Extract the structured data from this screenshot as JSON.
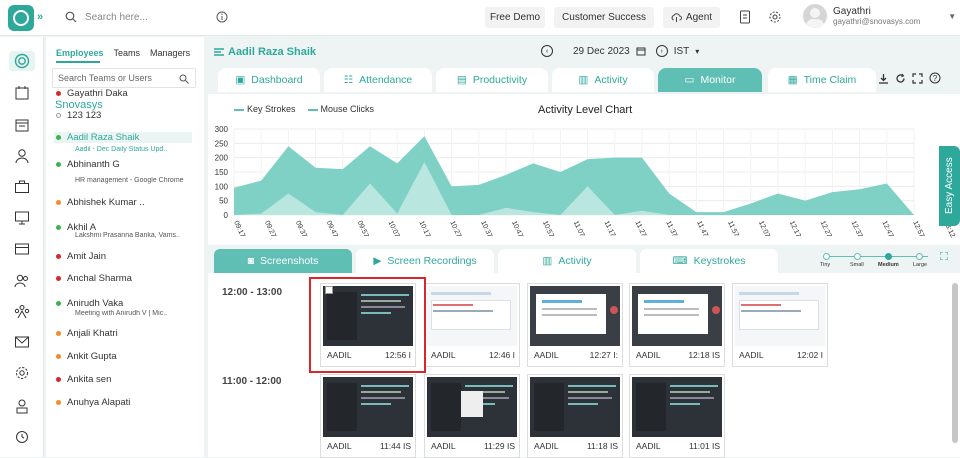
{
  "header": {
    "search_placeholder": "Search here...",
    "free_demo": "Free Demo",
    "customer_success": "Customer Success",
    "agent": "Agent",
    "user_name": "Gayathri",
    "user_email": "gayathri@snovasys.com"
  },
  "panel": {
    "tabs": [
      "Employees",
      "Teams",
      "Managers"
    ],
    "search_placeholder": "Search Teams or Users",
    "org": "Snovasys",
    "employees": [
      {
        "name": "Gayathri Daka",
        "status": "red"
      },
      {
        "name": "123 123",
        "status": "none"
      },
      {
        "name": "Aadil Raza Shaik",
        "status": "green",
        "sub": "Aadil - Dec Daily Status Upd.."
      },
      {
        "name": "Abhinanth G",
        "status": "green",
        "sub": "HR management - Google Chrome"
      },
      {
        "name": "Abhishek Kumar ..",
        "status": "orange"
      },
      {
        "name": "Akhil A",
        "status": "green",
        "sub": "Lakshmi Prasanna Banka, Vams.."
      },
      {
        "name": "Amit Jain",
        "status": "red"
      },
      {
        "name": "Anchal Sharma",
        "status": "red"
      },
      {
        "name": "Anirudh Vaka",
        "status": "green",
        "sub": "Meeting with Anirudh V | Mic.."
      },
      {
        "name": "Anjali Khatri",
        "status": "orange"
      },
      {
        "name": "Ankit Gupta",
        "status": "orange"
      },
      {
        "name": "Ankita sen",
        "status": "red"
      },
      {
        "name": "Anuhya Alapati",
        "status": "orange"
      }
    ]
  },
  "main": {
    "title": "Aadil Raza Shaik",
    "date": "29 Dec 2023",
    "timezone": "IST",
    "tabs": [
      "Dashboard",
      "Attendance",
      "Productivity",
      "Activity",
      "Monitor",
      "Time Claim"
    ],
    "sub_tabs": [
      "Screenshots",
      "Screen Recordings",
      "Activity",
      "Keystrokes"
    ],
    "sizes": [
      "Tiny",
      "Small",
      "Medium",
      "Large"
    ],
    "easy_access": "Easy Access"
  },
  "chart_data": {
    "type": "area",
    "title": "Activity Level Chart",
    "series": [
      {
        "name": "Key Strokes",
        "values": [
          0,
          0,
          0,
          0,
          0,
          0,
          0,
          0,
          0,
          0,
          0,
          0,
          0,
          0,
          0,
          0,
          0,
          0,
          0,
          0,
          0,
          0,
          0,
          0,
          0,
          0
        ]
      },
      {
        "name": "Mouse Clicks",
        "values": [
          95,
          120,
          240,
          165,
          160,
          240,
          180,
          275,
          100,
          105,
          140,
          180,
          150,
          195,
          200,
          200,
          75,
          10,
          10,
          40,
          75,
          50,
          80,
          90,
          110,
          0
        ]
      }
    ],
    "mouse_fill": [
      0,
      5,
      75,
      10,
      0,
      110,
      5,
      185,
      0,
      0,
      25,
      10,
      0,
      100,
      0,
      15,
      0,
      0,
      0,
      0,
      0,
      0,
      0,
      0,
      0,
      0
    ],
    "x": [
      "09:17",
      "09:27",
      "09:37",
      "09:47",
      "09:57",
      "10:07",
      "10:17",
      "10:27",
      "10:37",
      "10:47",
      "10:57",
      "11:07",
      "11:17",
      "11:27",
      "11:37",
      "11:47",
      "11:57",
      "12:07",
      "12:17",
      "12:27",
      "12:37",
      "12:47",
      "12:57",
      "13:07",
      "13:07",
      "13:12"
    ],
    "x_ticks": [
      "09:17",
      "09:27",
      "09:37",
      "09:47",
      "09:57",
      "10:07",
      "10:17",
      "10:27",
      "10:37",
      "10:47",
      "10:57",
      "11:07",
      "11:17",
      "11:27",
      "11:37",
      "11:47",
      "11:57",
      "12:07",
      "12:17",
      "12:27",
      "12:37",
      "12:47",
      "12:57",
      "13:12"
    ],
    "ylim": [
      0,
      300
    ],
    "y_ticks": [
      0,
      50,
      100,
      150,
      200,
      250,
      300
    ]
  },
  "gallery": {
    "groups": [
      {
        "label": "12:00 - 13:00",
        "shots": [
          {
            "user": "AADIL",
            "time": "12:56 I"
          },
          {
            "user": "AADIL",
            "time": "12:46 I"
          },
          {
            "user": "AADIL",
            "time": "12:27 I:"
          },
          {
            "user": "AADIL",
            "time": "12:18 IS"
          },
          {
            "user": "AADIL",
            "time": "12:02 I"
          }
        ]
      },
      {
        "label": "11:00 - 12:00",
        "shots": [
          {
            "user": "AADIL",
            "time": "11:44 IS"
          },
          {
            "user": "AADIL",
            "time": "11:29 IS"
          },
          {
            "user": "AADIL",
            "time": "11:18 IS"
          },
          {
            "user": "AADIL",
            "time": "11:01 IS"
          }
        ]
      }
    ]
  }
}
